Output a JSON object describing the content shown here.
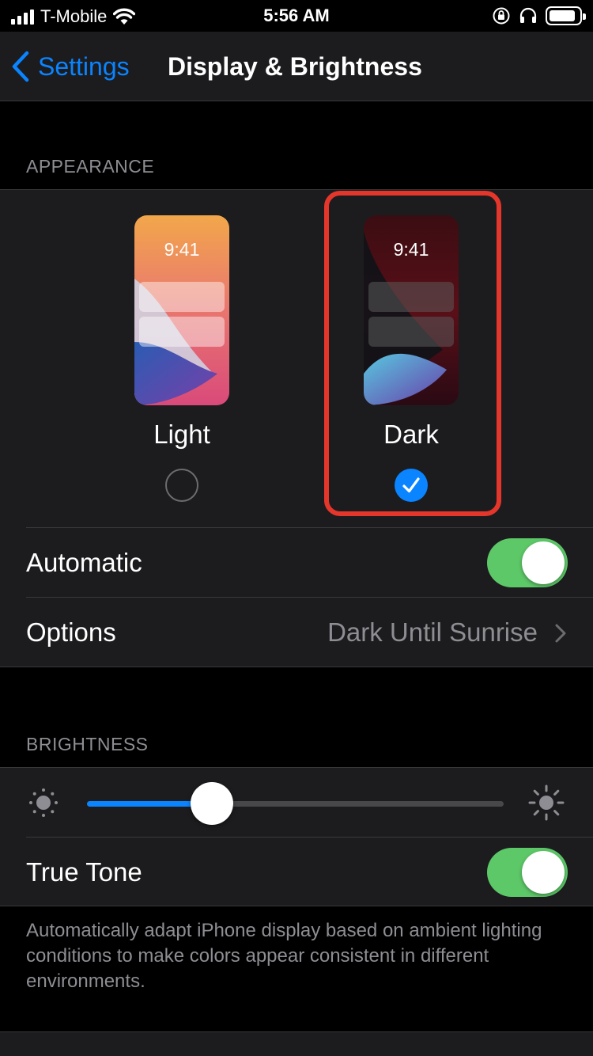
{
  "status_bar": {
    "carrier": "T-Mobile",
    "time": "5:56 AM",
    "icons": [
      "signal-icon",
      "wifi-icon",
      "orientation-lock-icon",
      "headphones-icon",
      "battery-icon"
    ],
    "battery_level": 0.9
  },
  "nav": {
    "back_label": "Settings",
    "title": "Display & Brightness"
  },
  "appearance": {
    "header": "APPEARANCE",
    "options": [
      {
        "label": "Light",
        "time": "9:41",
        "selected": false
      },
      {
        "label": "Dark",
        "time": "9:41",
        "selected": true
      }
    ],
    "highlight_color": "#e5362c"
  },
  "automatic": {
    "label": "Automatic",
    "on": true
  },
  "options_row": {
    "label": "Options",
    "value": "Dark Until Sunrise"
  },
  "brightness": {
    "header": "BRIGHTNESS",
    "level": 0.3,
    "icons": [
      "sun-low-icon",
      "sun-high-icon"
    ]
  },
  "true_tone": {
    "label": "True Tone",
    "on": true,
    "footer": "Automatically adapt iPhone display based on ambient lighting conditions to make colors appear consistent in different environments."
  },
  "colors": {
    "accent": "#0a84ff",
    "toggle_on": "#5dc868",
    "secondary_text": "#8d8d93",
    "cell_background": "#1c1c1e"
  }
}
